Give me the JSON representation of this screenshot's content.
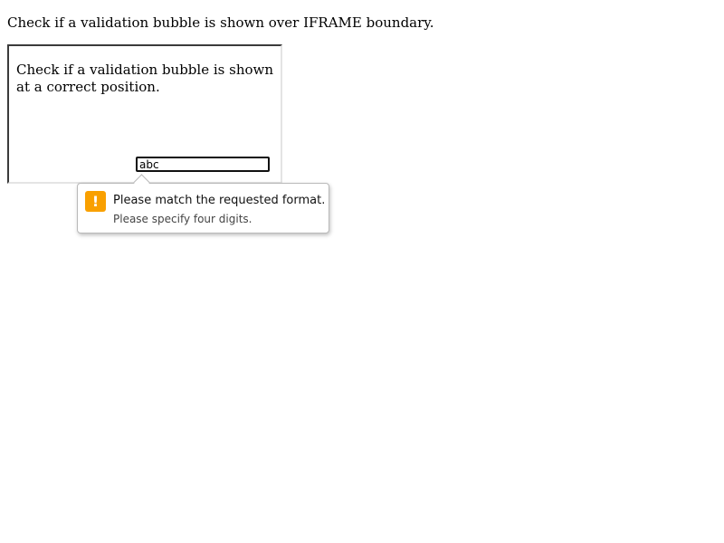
{
  "page": {
    "heading": "Check if a validation bubble is shown over IFRAME boundary."
  },
  "iframe": {
    "text": "Check if a validation bubble is shown at a correct position.",
    "input_value": "abc"
  },
  "validation_bubble": {
    "icon": "warning-icon",
    "icon_glyph": "!",
    "accent_color": "#f9a000",
    "title": "Please match the requested format.",
    "detail": "Please specify four digits."
  }
}
